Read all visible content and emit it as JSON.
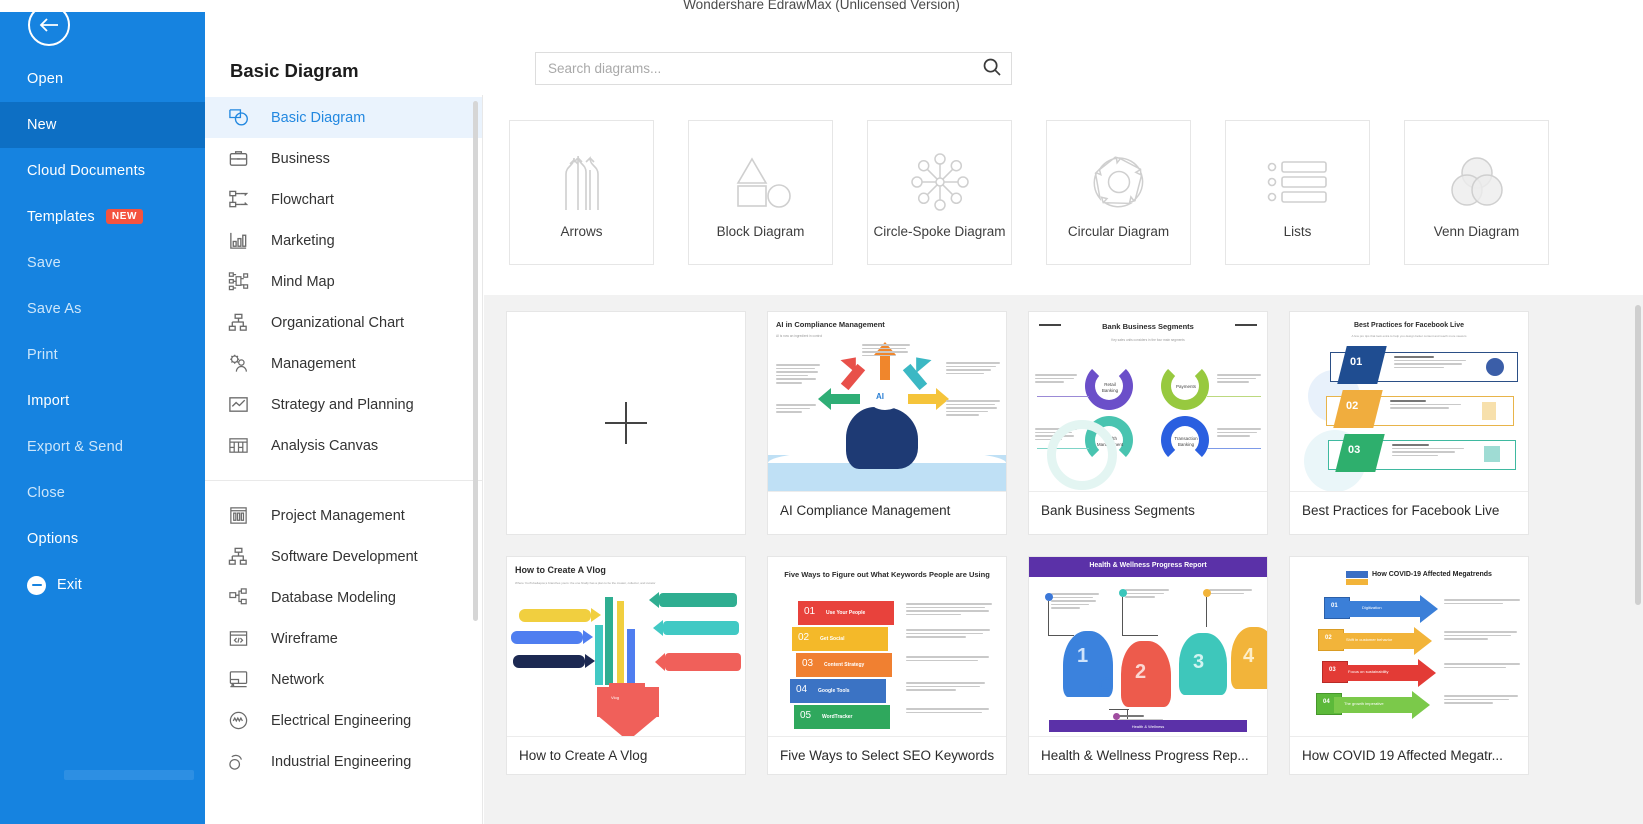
{
  "window": {
    "title": "Wondershare EdrawMax (Unlicensed Version)"
  },
  "colors": {
    "rail_blue": "#1683e0",
    "rail_active": "#0d6fc4",
    "badge_red": "#f4533f",
    "accent": "#2388e0",
    "content_bg": "#f2f2f2"
  },
  "rail": {
    "back_icon": "back-arrow-icon",
    "items": [
      {
        "label": "Open",
        "state": "normal"
      },
      {
        "label": "New",
        "state": "active"
      },
      {
        "label": "Cloud Documents",
        "state": "normal"
      },
      {
        "label": "Templates",
        "state": "normal",
        "badge": "NEW"
      },
      {
        "label": "Save",
        "state": "dim"
      },
      {
        "label": "Save As",
        "state": "dim"
      },
      {
        "label": "Print",
        "state": "dim"
      },
      {
        "label": "Import",
        "state": "normal"
      },
      {
        "label": "Export & Send",
        "state": "dim"
      },
      {
        "label": "Close",
        "state": "dim"
      },
      {
        "label": "Options",
        "state": "normal"
      },
      {
        "label": "Exit",
        "state": "normal",
        "icon": "exit-icon"
      }
    ]
  },
  "header": {
    "page_title": "Basic Diagram",
    "search": {
      "value": "",
      "placeholder": "Search diagrams...",
      "icon": "search-icon"
    }
  },
  "categories": {
    "group1": [
      {
        "label": "Basic Diagram",
        "icon": "basic-diagram-icon",
        "selected": true
      },
      {
        "label": "Business",
        "icon": "briefcase-icon",
        "selected": false
      },
      {
        "label": "Flowchart",
        "icon": "flowchart-icon",
        "selected": false
      },
      {
        "label": "Marketing",
        "icon": "bar-chart-icon",
        "selected": false
      },
      {
        "label": "Mind Map",
        "icon": "mind-map-icon",
        "selected": false
      },
      {
        "label": "Organizational Chart",
        "icon": "org-chart-icon",
        "selected": false
      },
      {
        "label": "Management",
        "icon": "management-gear-person-icon",
        "selected": false
      },
      {
        "label": "Strategy and Planning",
        "icon": "trend-line-icon",
        "selected": false
      },
      {
        "label": "Analysis Canvas",
        "icon": "canvas-grid-icon",
        "selected": false
      }
    ],
    "group2": [
      {
        "label": "Project Management",
        "icon": "gantt-icon"
      },
      {
        "label": "Software Development",
        "icon": "hierarchy-icon"
      },
      {
        "label": "Database Modeling",
        "icon": "database-nodes-icon"
      },
      {
        "label": "Wireframe",
        "icon": "wireframe-code-icon"
      },
      {
        "label": "Network",
        "icon": "network-devices-icon"
      },
      {
        "label": "Electrical Engineering",
        "icon": "waveform-circle-icon"
      },
      {
        "label": "Industrial Engineering",
        "icon": "industrial-icon"
      }
    ]
  },
  "diagram_types": [
    {
      "label": "Arrows",
      "icon": "arrows-icon"
    },
    {
      "label": "Block Diagram",
      "icon": "block-diagram-icon"
    },
    {
      "label": "Circle-Spoke Diagram",
      "icon": "circle-spoke-icon"
    },
    {
      "label": "Circular Diagram",
      "icon": "circular-diagram-icon"
    },
    {
      "label": "Lists",
      "icon": "lists-icon"
    },
    {
      "label": "Venn Diagram",
      "icon": "venn-diagram-icon"
    }
  ],
  "templates": {
    "blank": {
      "label": "",
      "icon": "plus-icon"
    },
    "row1": [
      {
        "name": "AI Compliance Management",
        "thumb_title": "AI in Compliance Management",
        "thumb_subtitle": "AI is now an ingredient in control"
      },
      {
        "name": "Bank Business Segments",
        "thumb_title": "Bank Business Segments",
        "thumb_subtitle": "Key sales units considers in the four main segments"
      },
      {
        "name": "Best Practices for Facebook Live",
        "thumb_title": "Best Practices for Facebook Live",
        "thumb_subtitle": "A few pro tips that look extra to help you design better content and reach more viewers",
        "steps": [
          "01",
          "02",
          "03"
        ]
      }
    ],
    "row2": [
      {
        "name": "How to Create A Vlog",
        "thumb_title": "How to Create A Vlog",
        "thumb_subtitle": "Where YouTube&apos;s branches yours: the one finally has a plan to be the creator, collector, and curator"
      },
      {
        "name": "Five Ways to Select SEO Keywords",
        "thumb_title": "Five Ways to Figure out What Keywords People are Using",
        "steps": [
          {
            "num": "01",
            "label": "Use Your People"
          },
          {
            "num": "02",
            "label": "Get Social"
          },
          {
            "num": "03",
            "label": "Content Strategy"
          },
          {
            "num": "04",
            "label": "Google Tools"
          },
          {
            "num": "05",
            "label": "WordTracker"
          }
        ]
      },
      {
        "name": "Health & Wellness Progress Rep...",
        "thumb_title": "Health & Wellness Progress Report",
        "steps": [
          "1",
          "2",
          "3",
          "4"
        ]
      },
      {
        "name": "How COVID 19 Affected Megatr...",
        "thumb_title": "How COVID-19 Affected Megatrends",
        "steps": [
          "01",
          "02",
          "03",
          "04"
        ]
      }
    ]
  }
}
